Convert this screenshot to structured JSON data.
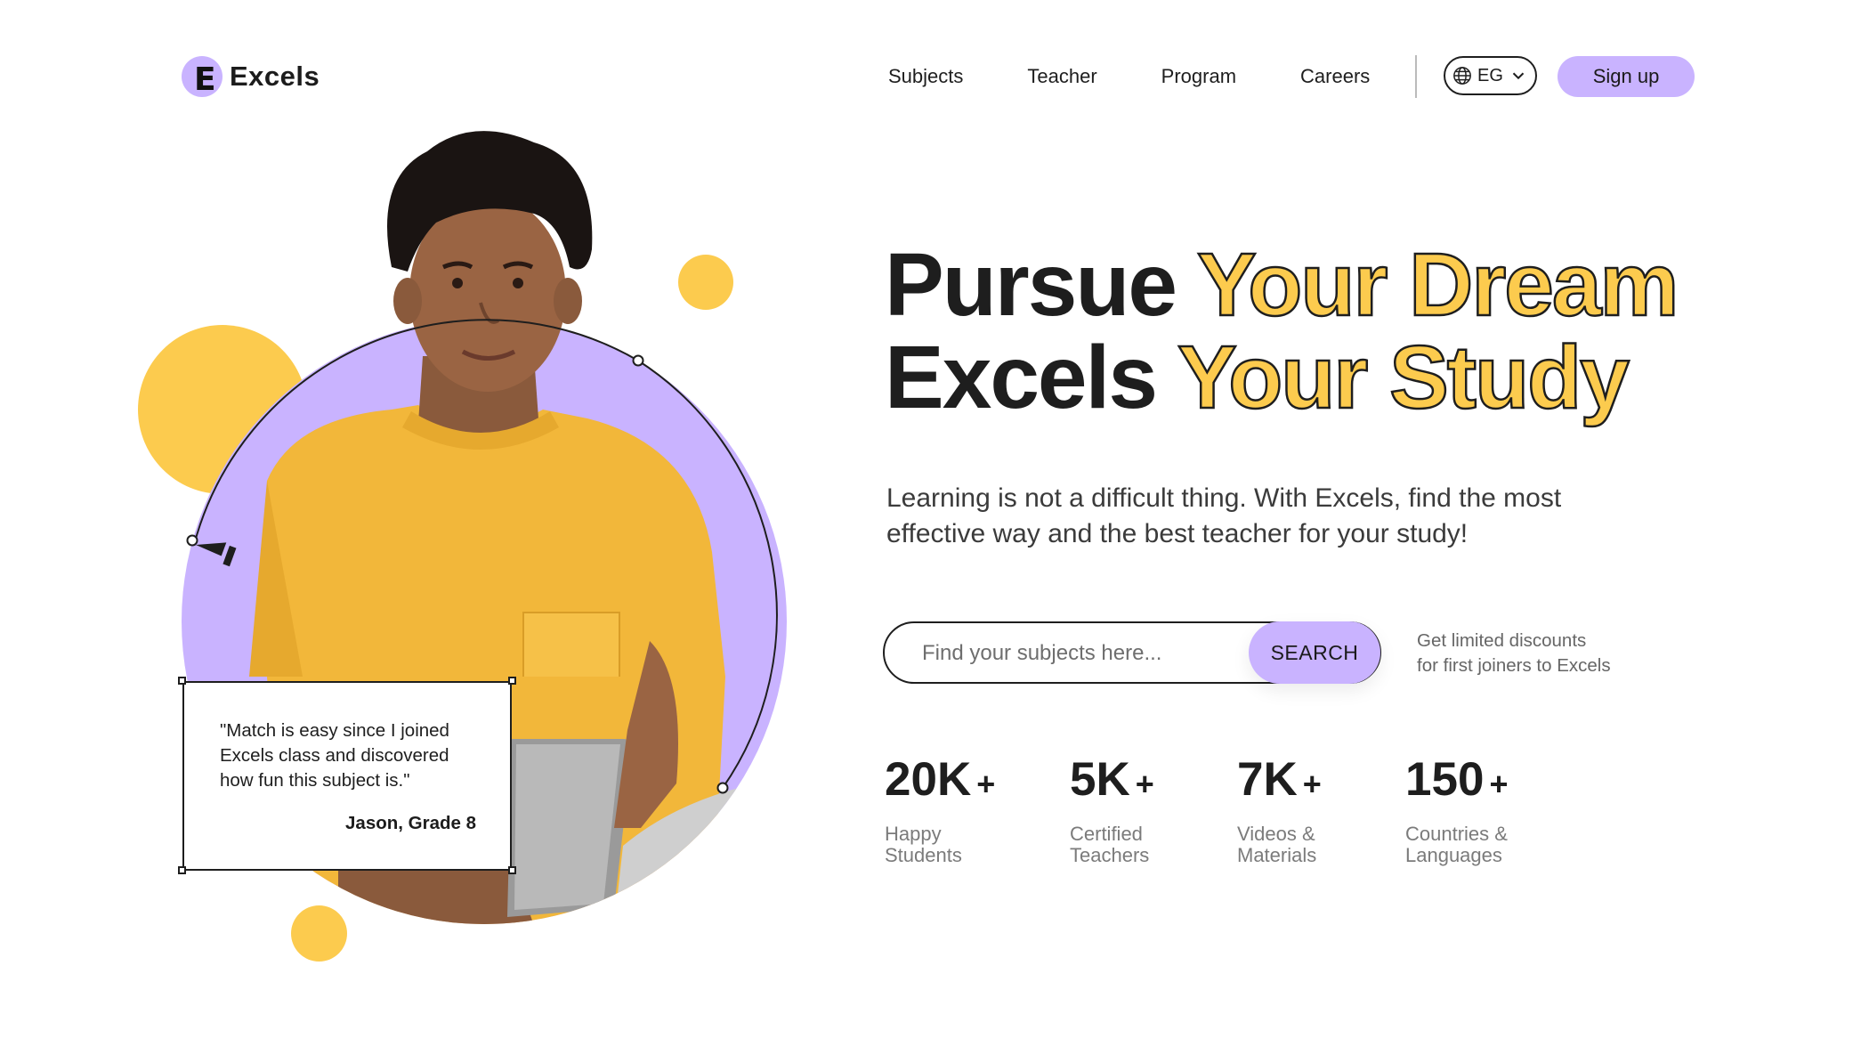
{
  "brand": {
    "name": "Excels",
    "mark_letter": "E"
  },
  "nav": {
    "items": [
      "Subjects",
      "Teacher",
      "Program",
      "Careers"
    ]
  },
  "language": {
    "code": "EG"
  },
  "signup": {
    "label": "Sign up"
  },
  "hero": {
    "line1_dark": "Pursue",
    "line1_gold": "Your Dream",
    "line2_dark": "Excels",
    "line2_gold": "Your Study",
    "subtitle": "Learning is not a difficult thing. With Excels, find the most effective way and the best teacher for your study!"
  },
  "search": {
    "placeholder": "Find your subjects here...",
    "button_label": "SEARCH"
  },
  "promo": {
    "line1": "Get limited discounts",
    "line2": "for first joiners to Excels"
  },
  "testimonial": {
    "quote": "\"Match is easy since I joined Excels class and discovered how fun this subject is.\"",
    "author": "Jason, Grade 8"
  },
  "stats": [
    {
      "value": "20K",
      "suffix": "+",
      "line1": "Happy",
      "line2": "Students"
    },
    {
      "value": "5K",
      "suffix": "+",
      "line1": "Certified",
      "line2": "Teachers"
    },
    {
      "value": "7K",
      "suffix": "+",
      "line1": "Videos &",
      "line2": "Materials"
    },
    {
      "value": "150",
      "suffix": "+",
      "line1": "Countries &",
      "line2": "Languages"
    }
  ],
  "colors": {
    "accent_purple": "#c9b3ff",
    "accent_yellow": "#fccb4e",
    "ink": "#1e1e1e"
  },
  "icons": [
    "globe-icon",
    "chevron-down-icon",
    "pen-tool-icon"
  ]
}
